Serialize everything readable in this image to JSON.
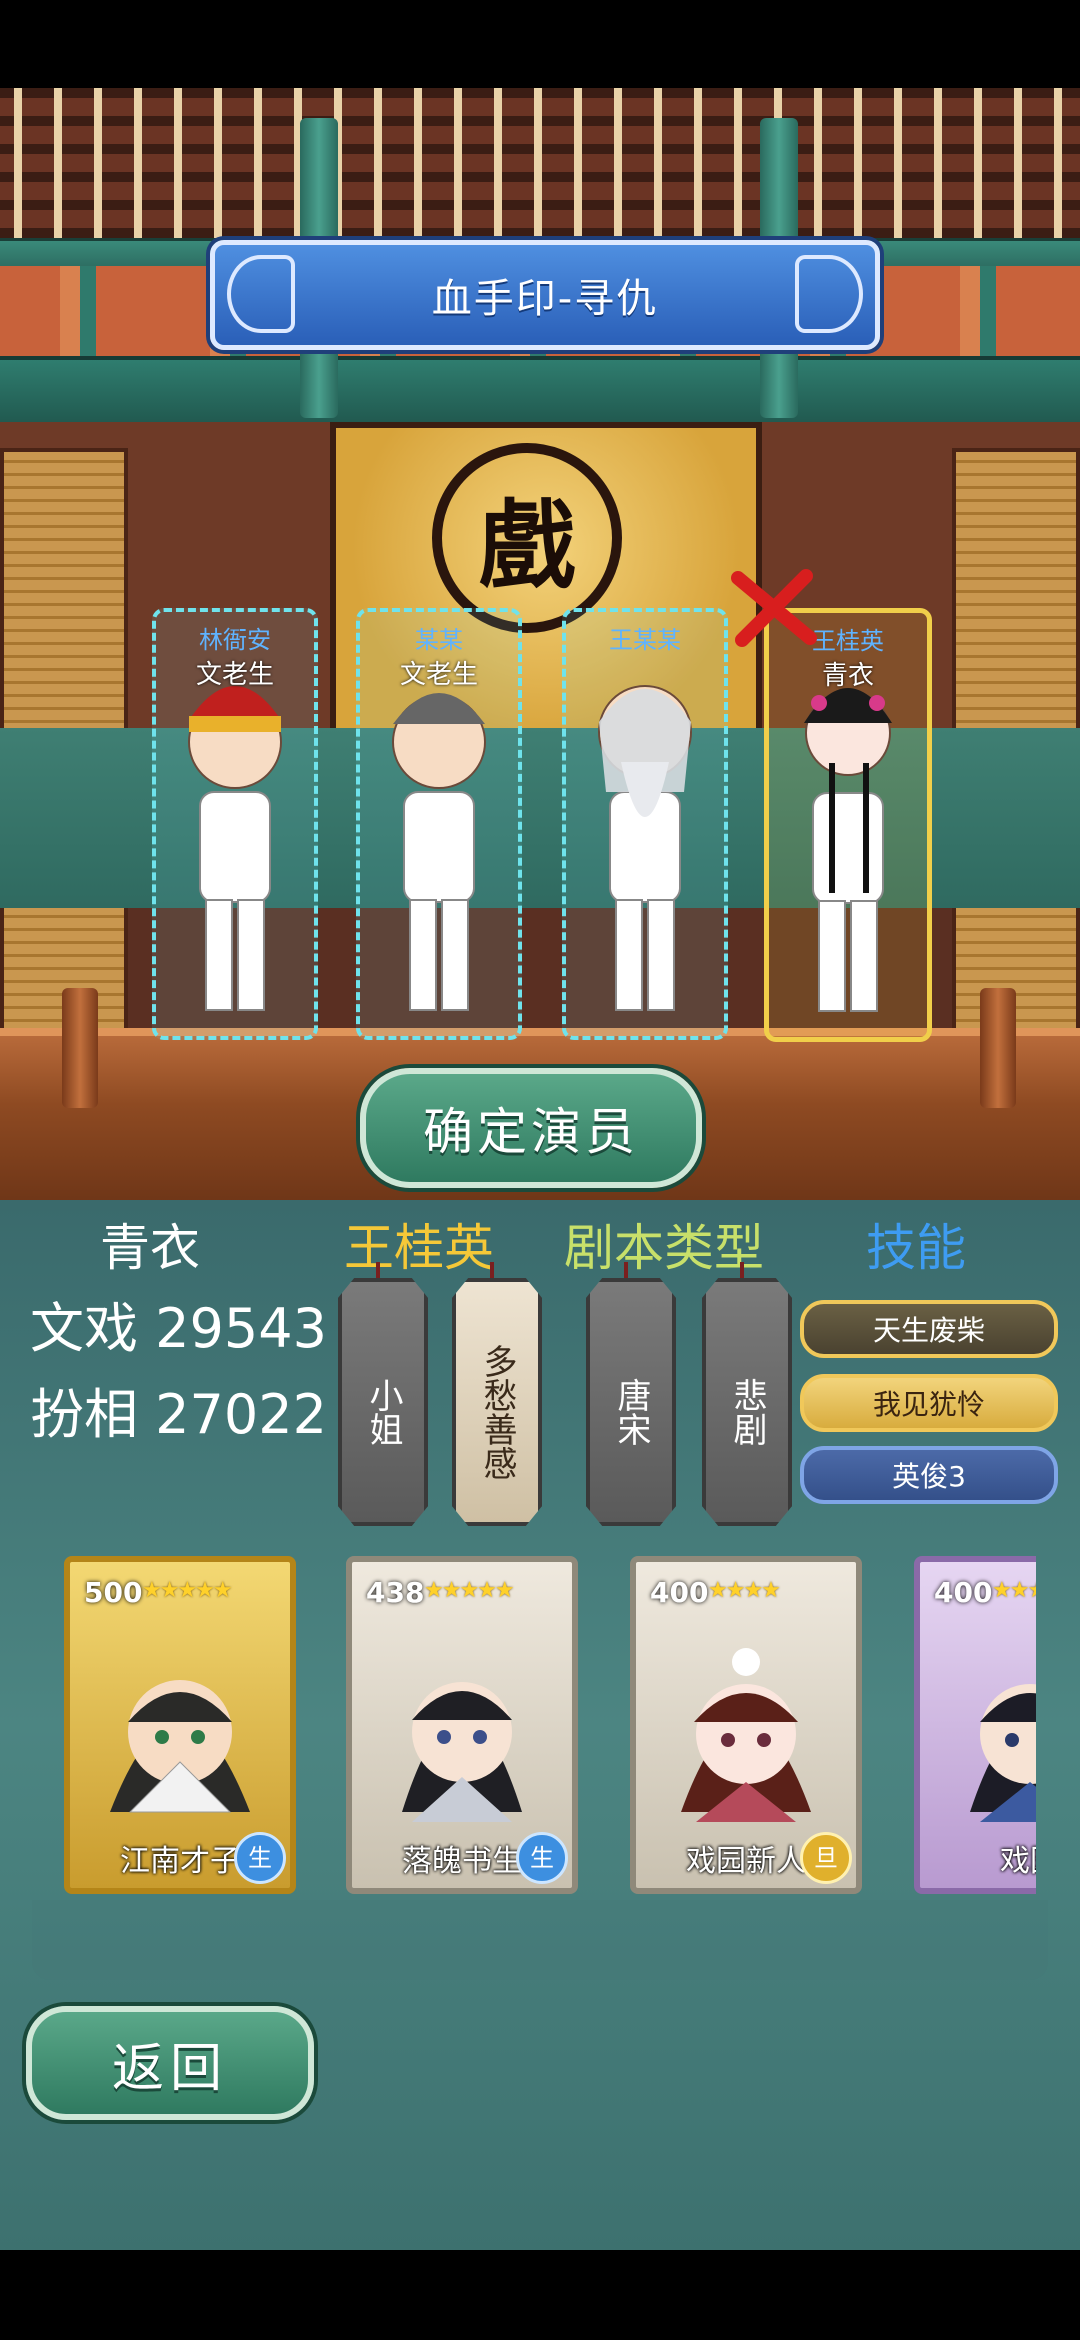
{
  "header": {
    "title": "血手印-寻仇"
  },
  "stage": {
    "backdrop_char": "戲",
    "slots": [
      {
        "name": "林衙安",
        "role": "文老生",
        "selected": false
      },
      {
        "name": "某某",
        "role": "文老生",
        "selected": false
      },
      {
        "name": "王某某",
        "role": "",
        "selected": false
      },
      {
        "name": "王桂英",
        "role": "青衣",
        "selected": true
      }
    ],
    "confirm_label": "确定演员"
  },
  "detail": {
    "role": "青衣",
    "actor_name": "王桂英",
    "script_type_label": "剧本类型",
    "skills_label": "技能",
    "stats": [
      {
        "label": "文戏",
        "value": "29543"
      },
      {
        "label": "扮相",
        "value": "27022"
      }
    ],
    "trait_tags": [
      "小姐",
      "多愁善感"
    ],
    "script_tags": [
      "唐宋",
      "悲剧"
    ],
    "skills": [
      "天生废柴",
      "我见犹怜",
      "英俊3"
    ]
  },
  "cards": [
    {
      "score": "500",
      "stars": "★★★★★",
      "name": "江南才子",
      "badge": "生",
      "frame": "gold"
    },
    {
      "score": "438",
      "stars": "★★★★★",
      "name": "落魄书生",
      "badge": "生",
      "frame": "silver"
    },
    {
      "score": "400",
      "stars": "★★★★",
      "name": "戏园新人",
      "badge": "旦",
      "frame": "silver"
    },
    {
      "score": "400",
      "stars": "★★★★",
      "name": "戏园",
      "badge": "",
      "frame": "purple"
    }
  ],
  "back_label": "返回",
  "colors": {
    "header_gold": "#f5c838",
    "header_green": "#c8e06a",
    "header_blue": "#3e9cf2",
    "selected_border": "#f1cf4a",
    "slot_border": "#6fe3ec"
  }
}
